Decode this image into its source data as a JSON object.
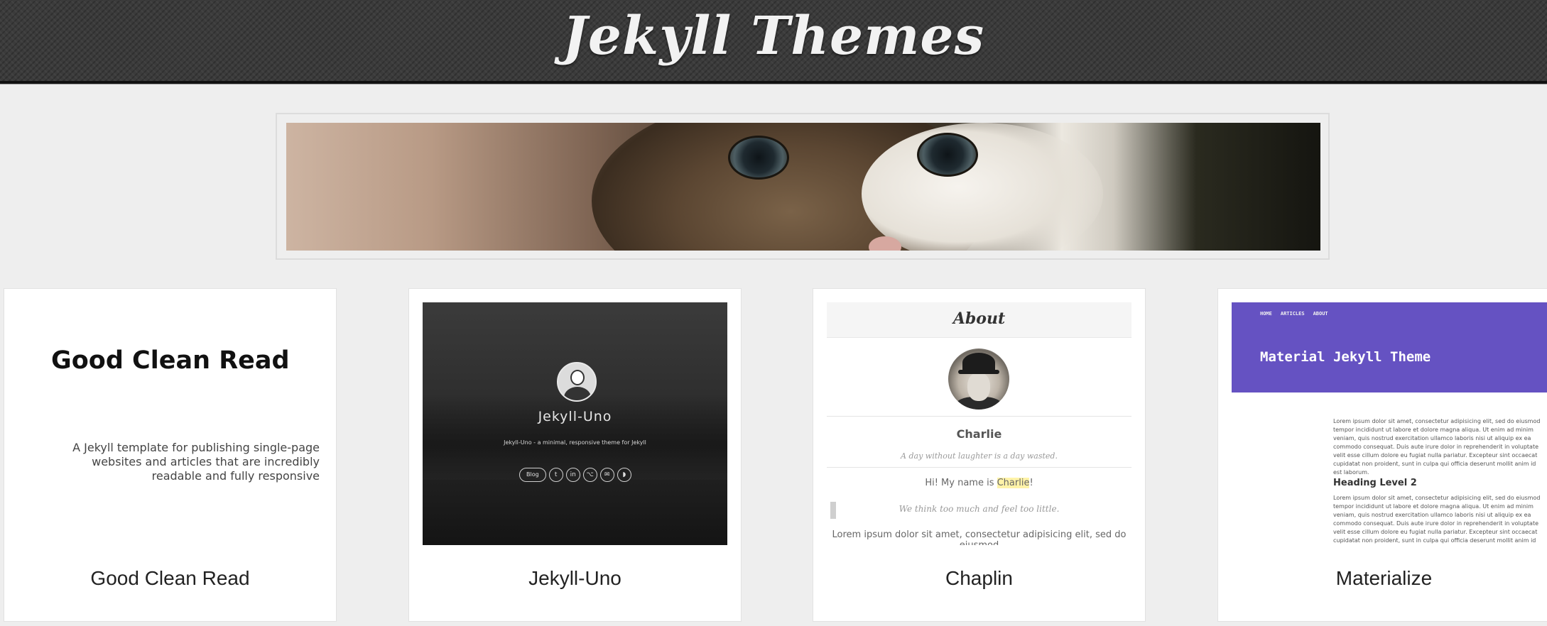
{
  "header": {
    "site_title": "Jekyll Themes"
  },
  "banner": {
    "image_alt": "kitten-banner"
  },
  "cards": [
    {
      "title": "Good Clean Read",
      "preview": {
        "heading": "Good Clean Read",
        "description": "A Jekyll template for publishing single-page websites and articles that are incredibly readable and fully responsive"
      }
    },
    {
      "title": "Jekyll-Uno",
      "preview": {
        "name": "Jekyll-Uno",
        "subtitle": "Jekyll-Uno - a minimal, responsive theme for Jekyll",
        "blog_label": "Blog",
        "icons": [
          "twitter-icon",
          "linkedin-icon",
          "github-icon",
          "email-icon",
          "rss-icon"
        ]
      }
    },
    {
      "title": "Chaplin",
      "preview": {
        "bar_title": "About",
        "name": "Charlie",
        "quote": "A day without laughter is a day wasted.",
        "hello_prefix": "Hi! My name is ",
        "hello_name": "Charlie",
        "hello_suffix": "!",
        "think": "We think too much and feel too little.",
        "lorem": "Lorem ipsum dolor sit amet, consectetur adipisicing elit, sed do eiusmod"
      }
    },
    {
      "title": "Materialize",
      "preview": {
        "nav": [
          "HOME",
          "ARTICLES",
          "ABOUT"
        ],
        "title": "Material Jekyll Theme",
        "para1": "Lorem ipsum dolor sit amet, consectetur adipisicing elit, sed do eiusmod tempor incididunt ut labore et dolore magna aliqua. Ut enim ad minim veniam, quis nostrud exercitation ullamco laboris nisi ut aliquip ex ea commodo consequat. Duis aute irure dolor in reprehenderit in voluptate velit esse cillum dolore eu fugiat nulla pariatur. Excepteur sint occaecat cupidatat non proident, sunt in culpa qui officia deserunt mollit anim id est laborum.",
        "h2": "Heading Level 2",
        "para2": "Lorem ipsum dolor sit amet, consectetur adipisicing elit, sed do eiusmod tempor incididunt ut labore et dolore magna aliqua. Ut enim ad minim veniam, quis nostrud exercitation ullamco laboris nisi ut aliquip ex ea commodo consequat. Duis aute irure dolor in reprehenderit in voluptate velit esse cillum dolore eu fugiat nulla pariatur. Excepteur sint occaecat cupidatat non proident, sunt in culpa qui officia deserunt mollit anim id est laborum."
      }
    }
  ],
  "colors": {
    "header_bg": "#3b3b3b",
    "page_bg": "#eeeeee",
    "material_purple": "#6552c2",
    "highlight": "#fff3a8"
  }
}
